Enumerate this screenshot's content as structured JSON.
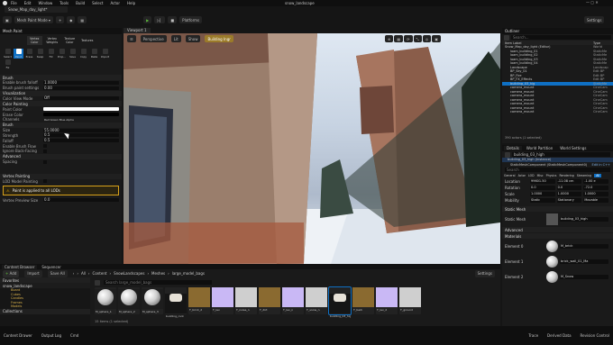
{
  "window": {
    "app_menu": [
      "File",
      "Edit",
      "Window",
      "Tools",
      "Build",
      "Select",
      "Actor",
      "Help"
    ],
    "project_tabs": [
      "Snow_Map_day_light*",
      "snow_landscape"
    ]
  },
  "toolbar": {
    "mode": "Mesh Paint Mode",
    "platforms": "Platforms",
    "settings": "Settings"
  },
  "mesh_paint": {
    "title": "Mesh Paint",
    "tabs": [
      "Vertex Color",
      "Vertex Weights",
      "Texture Color",
      "Textures"
    ],
    "tools": [
      "Select",
      "Paint",
      "Erase",
      "Swap",
      "Fill",
      "Prop...",
      "Save",
      "Copy",
      "Paste",
      "Import",
      "Fix"
    ],
    "brush_header": "Brush",
    "rows": [
      {
        "k": "Enable brush falloff",
        "v": "1.0000"
      },
      {
        "k": "Brush paint settings",
        "v": "0.00"
      }
    ],
    "sections": [
      "Visualization",
      "Color Painting",
      "Brush",
      "Advanced",
      "Vertex Painting"
    ],
    "vis_rows": [
      {
        "k": "Color View Mode",
        "v": "Off"
      }
    ],
    "paint_rows": [
      {
        "k": "Paint Color",
        "v": ""
      },
      {
        "k": "Erase Color",
        "v": ""
      },
      {
        "k": "Channels",
        "v": "Red  Green  Blue  Alpha"
      }
    ],
    "brush_rows": [
      {
        "k": "Size",
        "v": "55.0000"
      },
      {
        "k": "Strength",
        "v": "0.5"
      },
      {
        "k": "Falloff",
        "v": "0.5"
      },
      {
        "k": "Enable Brush Flow",
        "v": ""
      },
      {
        "k": "Ignore Back-Facing",
        "v": ""
      },
      {
        "k": "Spacing",
        "v": ""
      }
    ],
    "lod_row": {
      "k": "LOD Model Painting",
      "v": ""
    },
    "notice": "Paint is applied to all LODs",
    "vp_row": {
      "k": "Vertex Preview Size",
      "v": "0.0"
    }
  },
  "viewport": {
    "tab": "Viewport 1",
    "buttons": [
      "Perspective",
      "Lit",
      "Show",
      "Building Ingr"
    ]
  },
  "outliner": {
    "title": "Outliner",
    "filter": "Search...",
    "cols": [
      "Item Label",
      "Type"
    ],
    "items": [
      {
        "n": "Snow_Map_day_light (Editor)",
        "t": "World"
      },
      {
        "n": "loam_building_01",
        "t": "StaticMe"
      },
      {
        "n": "loam_building_02",
        "t": "StaticMe"
      },
      {
        "n": "loam_building_03",
        "t": "StaticMe"
      },
      {
        "n": "loam_building_04",
        "t": "StaticMe"
      },
      {
        "n": "Landscape",
        "t": "Landscap"
      },
      {
        "n": "BP_Sky_01",
        "t": "Edit BP"
      },
      {
        "n": "BP_Fire",
        "t": "Edit BP"
      },
      {
        "n": "BP_FX_Effects",
        "t": "Edit BP"
      },
      {
        "n": "building_03_hig",
        "t": "StaticMe"
      },
      {
        "n": "camera_mount",
        "t": "CineCam"
      },
      {
        "n": "camera_mount",
        "t": "CineCam"
      },
      {
        "n": "camera_mount",
        "t": "CineCam"
      },
      {
        "n": "camera_mount",
        "t": "CineCam"
      },
      {
        "n": "camera_mount",
        "t": "CineCam"
      },
      {
        "n": "camera_mount",
        "t": "CineCam"
      },
      {
        "n": "camera_mount",
        "t": "CineCam"
      }
    ],
    "count": "390 actors (1 selected)"
  },
  "details": {
    "tabs": [
      "Details",
      "World Partition",
      "World Settings"
    ],
    "actor": "building_03_high",
    "component": "building_03_high (Instance)",
    "mesh_comp": "StaticMeshComponent (StaticMeshComponent0)",
    "edit_cpp": "Edit in C++",
    "search": "Search",
    "subtabs": [
      "General",
      "Actor",
      "LOD",
      "Misc",
      "Physics",
      "Rendering",
      "Streaming",
      "All"
    ],
    "transform": [
      {
        "k": "Location",
        "v": [
          "99601.50",
          "-11.08 cm",
          "-1.00 e"
        ]
      },
      {
        "k": "Rotation",
        "v": [
          "0.0",
          "0.0",
          "-72.0"
        ]
      },
      {
        "k": "Scale",
        "v": [
          "1.0000",
          "1.0000",
          "1.0000"
        ]
      }
    ],
    "mobility": {
      "k": "Mobility",
      "v": [
        "Static",
        "Stationary",
        "Movable"
      ]
    },
    "sm_header": "Static Mesh",
    "sm_label": "Static Mesh",
    "sm_value": "building_03_high",
    "adv": "Advanced",
    "mats": "Materials",
    "materials": [
      {
        "k": "Element 0",
        "v": "M_brick"
      },
      {
        "k": "Element 1",
        "v": "brick_wall_01_Ma"
      },
      {
        "k": "Element 2",
        "v": "M_Snow"
      }
    ]
  },
  "content_browser": {
    "tabs": [
      "Content Browser",
      "Sequencer"
    ],
    "add": "Add",
    "import": "Import",
    "save_all": "Save All",
    "path": [
      "All",
      "Content",
      "SnowLandscapes",
      "Meshes",
      "large_model_bags"
    ],
    "settings": "Settings",
    "favorites": "Favorites",
    "root": "snow_landscape",
    "folders": [
      "Board",
      "Cubes",
      "Candles",
      "Frames",
      "Models"
    ],
    "collections": "Collections",
    "count": "15 items (1 selected)",
    "search": "Search large_model_bags",
    "assets": [
      {
        "n": "M_sphere_1",
        "k": "sphere"
      },
      {
        "n": "M_sphere_2",
        "k": "sphere"
      },
      {
        "n": "M_sphere_3",
        "k": "sphere"
      },
      {
        "n": "building_rock",
        "k": "rock"
      },
      {
        "n": "T_brick_d",
        "k": "brown"
      },
      {
        "n": "T_lav",
        "k": "lav"
      },
      {
        "n": "T_noise_n",
        "k": "grey"
      },
      {
        "n": "T_dirt",
        "k": "brown"
      },
      {
        "n": "T_lav_n",
        "k": "lav"
      },
      {
        "n": "T_snow_n",
        "k": "grey"
      },
      {
        "n": "building_03_high",
        "k": "rock"
      },
      {
        "n": "T_bark",
        "k": "brown"
      },
      {
        "n": "T_lav_2",
        "k": "lav"
      },
      {
        "n": "T_ground",
        "k": "grey"
      }
    ]
  },
  "statusbar": {
    "items": [
      "Content Drawer",
      "Output Log",
      "Cmd"
    ],
    "right": [
      "Trace",
      "Derived Data",
      "Revision Control"
    ]
  }
}
